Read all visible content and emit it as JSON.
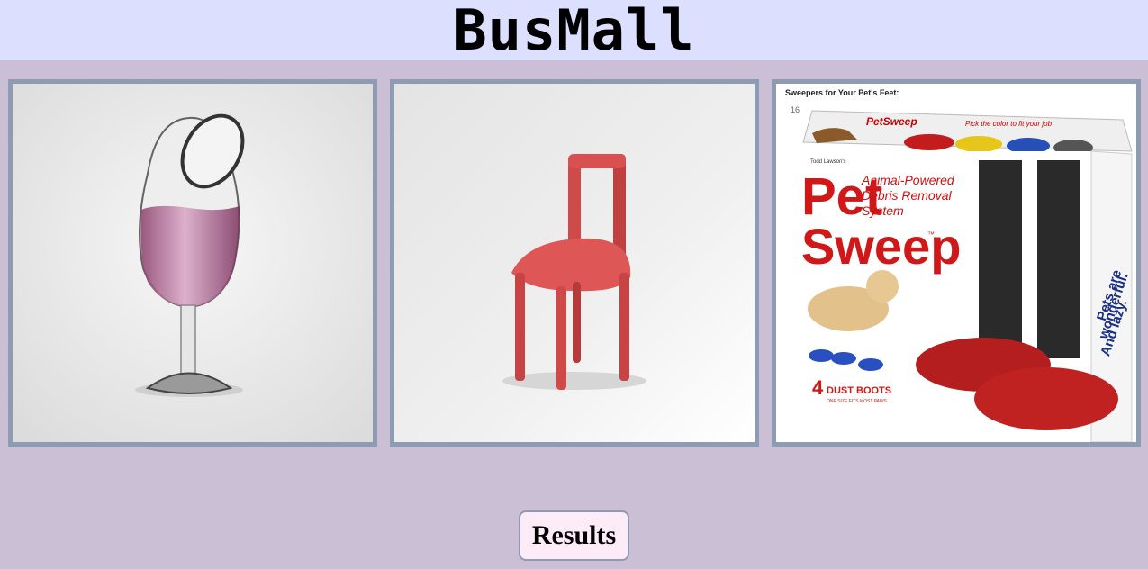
{
  "header": {
    "title": "BusMall"
  },
  "products": [
    {
      "name": "wine-glass",
      "icon": "wine-glass-image"
    },
    {
      "name": "chair",
      "icon": "chair-image"
    },
    {
      "name": "pet-sweep",
      "icon": "pet-sweep-image",
      "caption": "Sweepers for Your Pet's Feet:",
      "number": "16",
      "box_logo": "PetSweep",
      "box_tag": "Pick the color to fit your job",
      "brand_small": "Todd Lawson's",
      "title_line1": "Pet",
      "title_line2": "Sweep",
      "tm": "™",
      "subtitle_line1": "Animal-Powered",
      "subtitle_line2": "Debris Removal",
      "subtitle_line3": "System",
      "boots_number": "4",
      "boots_label": "DUST BOOTS",
      "boots_sub": "ONE SIZE FITS MOST PAWS",
      "side_line1": "Pets are",
      "side_line2": "wonderful.",
      "side_line3": "And lazy."
    }
  ],
  "results_button": {
    "label": "Results"
  },
  "colors": {
    "page_bg": "#cbbfd5",
    "header_bg": "#dcdffd",
    "frame_border": "#8e9cb3",
    "button_bg": "#fdebf7"
  }
}
